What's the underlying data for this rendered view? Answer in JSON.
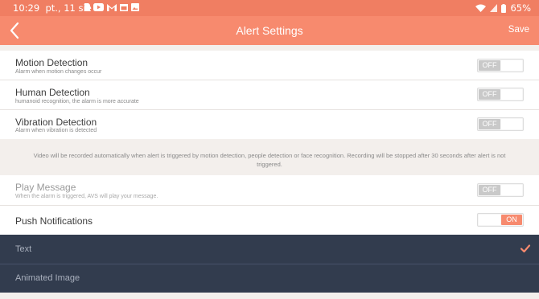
{
  "status_bar": {
    "time": "10:29",
    "date": "pt., 11 sie",
    "battery": "65%",
    "icons_left": [
      "sim-icon",
      "youtube-icon",
      "gmail-icon",
      "calendar-icon",
      "gallery-icon"
    ],
    "icons_right": [
      "wifi-icon",
      "signal-icon",
      "battery-icon"
    ]
  },
  "app_bar": {
    "title": "Alert Settings",
    "save_label": "Save",
    "back_icon": "chevron-left-icon",
    "accent": "#f78a6e"
  },
  "settings": [
    {
      "label": "Motion Detection",
      "sub": "Alarm when motion changes occur",
      "state": "OFF"
    },
    {
      "label": "Human Detection",
      "sub": "humanoid recognition, the alarm is more accurate",
      "state": "OFF"
    },
    {
      "label": "Vibration Detection",
      "sub": "Alarm when vibration is detected",
      "state": "OFF"
    }
  ],
  "note": "Video will be recorded automatically when alert is triggered by motion detection, people detection or face recognition. Recording will be stopped after 30 seconds after alert is not triggered.",
  "play_message": {
    "label": "Play Message",
    "sub": "When the alarm is triggered, AVS will play your message.",
    "state": "OFF"
  },
  "push_notifications": {
    "label": "Push Notifications",
    "state": "ON"
  },
  "sheet": {
    "options": [
      {
        "label": "Text",
        "selected": true
      },
      {
        "label": "Animated Image",
        "selected": false
      }
    ],
    "background": "#323c4e",
    "check_color": "#f78a6e"
  }
}
